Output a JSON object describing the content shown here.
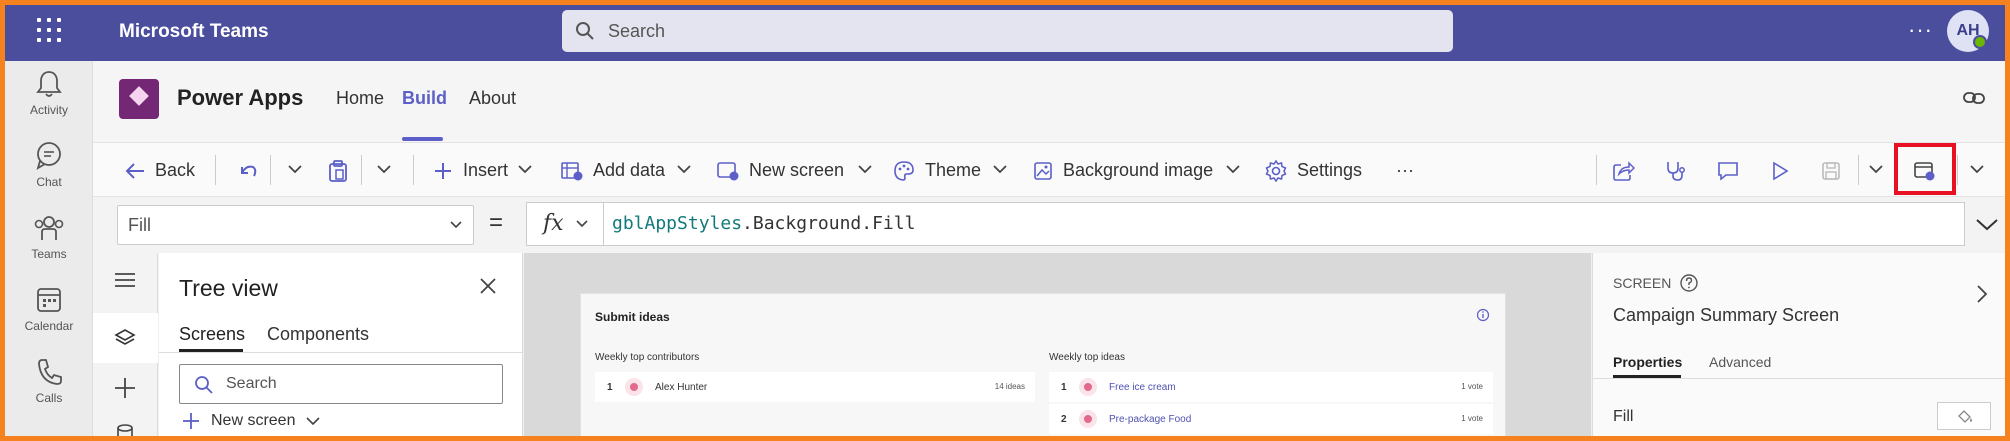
{
  "teams": {
    "app_name": "Microsoft Teams",
    "search_placeholder": "Search",
    "more_label": "···",
    "avatar_initials": "AH",
    "rail": [
      {
        "label": "Activity",
        "icon": "bell-icon"
      },
      {
        "label": "Chat",
        "icon": "chat-icon"
      },
      {
        "label": "Teams",
        "icon": "teams-icon"
      },
      {
        "label": "Calendar",
        "icon": "calendar-icon"
      },
      {
        "label": "Calls",
        "icon": "phone-icon"
      }
    ]
  },
  "powerapps": {
    "title": "Power Apps",
    "nav": [
      {
        "label": "Home"
      },
      {
        "label": "Build",
        "active": true
      },
      {
        "label": "About"
      }
    ],
    "accent": "#5b5fc7",
    "logo_color": "#742774"
  },
  "commands": {
    "back": "Back",
    "insert": "Insert",
    "add_data": "Add data",
    "new_screen": "New screen",
    "theme": "Theme",
    "background_image": "Background image",
    "settings": "Settings",
    "more": "···"
  },
  "formula_bar": {
    "property": "Fill",
    "equals": "=",
    "fx": "fx",
    "formula_var": "gblAppStyles",
    "formula_rest": ".Background.Fill"
  },
  "tree_view": {
    "title": "Tree view",
    "tabs": [
      "Screens",
      "Components"
    ],
    "search_placeholder": "Search",
    "new_screen": "New screen"
  },
  "canvas_app": {
    "title": "Submit ideas",
    "contributors_title": "Weekly top contributors",
    "ideas_title": "Weekly top ideas",
    "contributors": [
      {
        "rank": "1",
        "name": "Alex Hunter",
        "count": "14 ideas"
      }
    ],
    "ideas": [
      {
        "rank": "1",
        "name": "Free ice cream",
        "count": "1 vote"
      },
      {
        "rank": "2",
        "name": "Pre-package Food",
        "count": "1 vote"
      }
    ]
  },
  "properties_pane": {
    "kind": "SCREEN",
    "name": "Campaign Summary Screen",
    "tabs": [
      "Properties",
      "Advanced"
    ],
    "first_property": "Fill"
  },
  "highlight_color": "#e81123"
}
